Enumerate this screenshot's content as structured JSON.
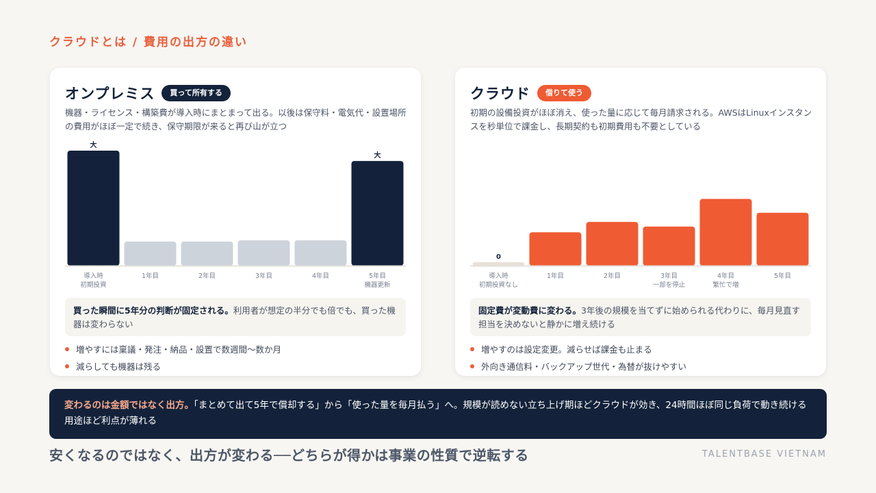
{
  "eyebrow": "クラウドとは / 費用の出方の違い",
  "colors": {
    "navy": "#13223a",
    "orange": "#ef5b33",
    "gray_bar": "#cdd3da",
    "zero_bar": "#e6e1d8",
    "accent": "#e8603c"
  },
  "onprem": {
    "title": "オンプレミス",
    "badge": "買って所有する",
    "desc": "機器・ライセンス・構築費が導入時にまとまって出る。以後は保守料・電気代・設置場所の費用がほぼ一定で続き、保守期限が来ると再び山が立つ",
    "note_bold": "買った瞬間に5年分の判断が固定される。",
    "note_rest": "利用者が想定の半分でも倍でも、買った機器は変わらない",
    "bullets": [
      "増やすには稟議・発注・納品・設置で数週間〜数か月",
      "減らしても機器は残る"
    ]
  },
  "cloud": {
    "title": "クラウド",
    "badge": "借りて使う",
    "desc": "初期の設備投資がほぼ消え、使った量に応じて毎月請求される。AWSはLinuxインスタンスを秒単位で課金し、長期契約も初期費用も不要としている",
    "note_bold": "固定費が変動費に変わる。",
    "note_rest": "3年後の規模を当てずに始められる代わりに、毎月見直す担当を決めないと静かに増え続ける",
    "bullets": [
      "増やすのは設定変更。減らせば課金も止まる",
      "外向き通信料・バックアップ世代・為替が抜けやすい"
    ]
  },
  "chart_data": [
    {
      "type": "bar",
      "categories": [
        "導入時\n初期投資",
        "1年目",
        "2年目",
        "3年目",
        "4年目",
        "5年目\n機器更新"
      ],
      "values": [
        100,
        21,
        21,
        22,
        22,
        91
      ],
      "value_labels": [
        "大",
        "",
        "",
        "",
        "",
        "大"
      ],
      "bar_colors": [
        "#13223a",
        "#cdd3da",
        "#cdd3da",
        "#cdd3da",
        "#cdd3da",
        "#13223a"
      ],
      "ylim": [
        0,
        100
      ],
      "grid": false
    },
    {
      "type": "bar",
      "categories": [
        "導入時\n初期投資なし",
        "1年目",
        "2年目",
        "3年目\n一部を停止",
        "4年目\n繁忙で増",
        "5年目"
      ],
      "values": [
        3,
        29,
        38,
        34,
        58,
        46
      ],
      "value_labels": [
        "0",
        "",
        "",
        "",
        "",
        ""
      ],
      "bar_colors": [
        "#e6e1d8",
        "#ef5b33",
        "#ef5b33",
        "#ef5b33",
        "#ef5b33",
        "#ef5b33"
      ],
      "ylim": [
        0,
        100
      ],
      "grid": false
    }
  ],
  "banner": {
    "highlight": "変わるのは金額ではなく出方。",
    "text": "「まとめて出て5年で償却する」から「使った量を毎月払う」へ。規模が読めない立ち上げ期ほどクラウドが効き、24時間ほぼ同じ負荷で動き続ける用途ほど利点が薄れる"
  },
  "footer": "安くなるのではなく、出方が変わる──どちらが得かは事業の性質で逆転する",
  "brand": "TALENTBASE VIETNAM"
}
